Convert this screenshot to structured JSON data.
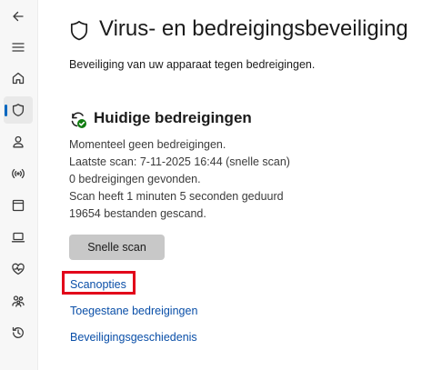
{
  "nav": {
    "items": [
      {
        "name": "back-icon"
      },
      {
        "name": "menu-icon"
      },
      {
        "name": "home-icon"
      },
      {
        "name": "shield-icon",
        "active": true
      },
      {
        "name": "account-icon"
      },
      {
        "name": "wireless-icon"
      },
      {
        "name": "app-browser-icon"
      },
      {
        "name": "laptop-icon"
      },
      {
        "name": "heart-pulse-icon"
      },
      {
        "name": "family-icon"
      },
      {
        "name": "history-icon"
      }
    ],
    "accent_color": "#0067c0"
  },
  "header": {
    "title": "Virus- en bedreigingsbeveiliging",
    "subtitle": "Beveiliging van uw apparaat tegen bedreigingen."
  },
  "current_threats": {
    "title": "Huidige bedreigingen",
    "status_icon": "shield-check-icon",
    "status_color": "#107c10",
    "lines": [
      "Momenteel geen bedreigingen.",
      "Laatste scan: 7-11-2025 16:44 (snelle scan)",
      "0 bedreigingen gevonden.",
      "Scan heeft 1 minuten 5 seconden geduurd",
      "19654 bestanden gescand."
    ],
    "quick_scan_label": "Snelle scan"
  },
  "links": {
    "scan_options": "Scanopties",
    "allowed_threats": "Toegestane bedreigingen",
    "protection_history": "Beveiligingsgeschiedenis"
  },
  "highlight_color": "#e2001a"
}
